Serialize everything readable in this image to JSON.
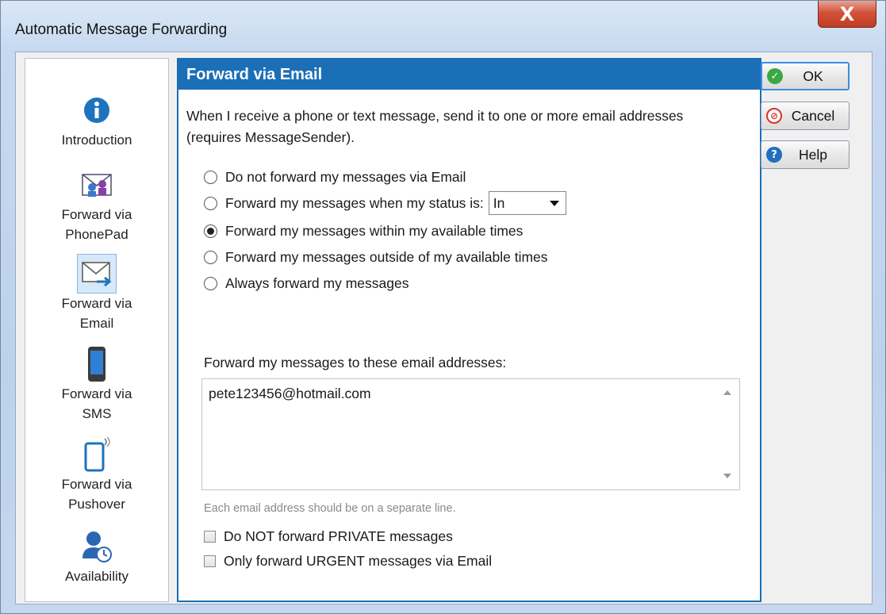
{
  "window": {
    "title": "Automatic Message Forwarding",
    "close_glyph": "X"
  },
  "nav": {
    "items": [
      {
        "label": "Introduction",
        "icon": "info-icon"
      },
      {
        "label": "Forward via PhonePad",
        "icon": "phonepad-icon"
      },
      {
        "label": "Forward via Email",
        "icon": "email-icon",
        "selected": true
      },
      {
        "label": "Forward via SMS",
        "icon": "phone-icon"
      },
      {
        "label": "Forward via Pushover",
        "icon": "pushover-icon"
      },
      {
        "label": "Availability",
        "icon": "availability-icon"
      }
    ]
  },
  "panel": {
    "header": "Forward via Email",
    "description": "When I receive a phone or text message, send it to one or more email addresses (requires MessageSender).",
    "options": [
      {
        "label": "Do not forward my messages via Email",
        "checked": false
      },
      {
        "label": "Forward my messages when my status is:",
        "checked": false
      },
      {
        "label": "Forward my messages within my available times",
        "checked": true
      },
      {
        "label": "Forward my messages outside of my available times",
        "checked": false
      },
      {
        "label": "Always forward my messages",
        "checked": false
      }
    ],
    "status_value": "In",
    "addresses_label": "Forward my messages to these email addresses:",
    "addresses_value": "pete123456@hotmail.com",
    "hint": "Each email address should be on a separate line.",
    "checkboxes": [
      {
        "label": "Do NOT forward PRIVATE messages",
        "checked": false
      },
      {
        "label": "Only forward URGENT messages via Email",
        "checked": false
      }
    ]
  },
  "buttons": {
    "ok": "OK",
    "cancel": "Cancel",
    "help": "Help"
  },
  "colors": {
    "accent": "#1b6fb7",
    "ok_icon": "#3aa845",
    "cancel_icon": "#d8322a",
    "help_icon": "#1f6fc0"
  }
}
